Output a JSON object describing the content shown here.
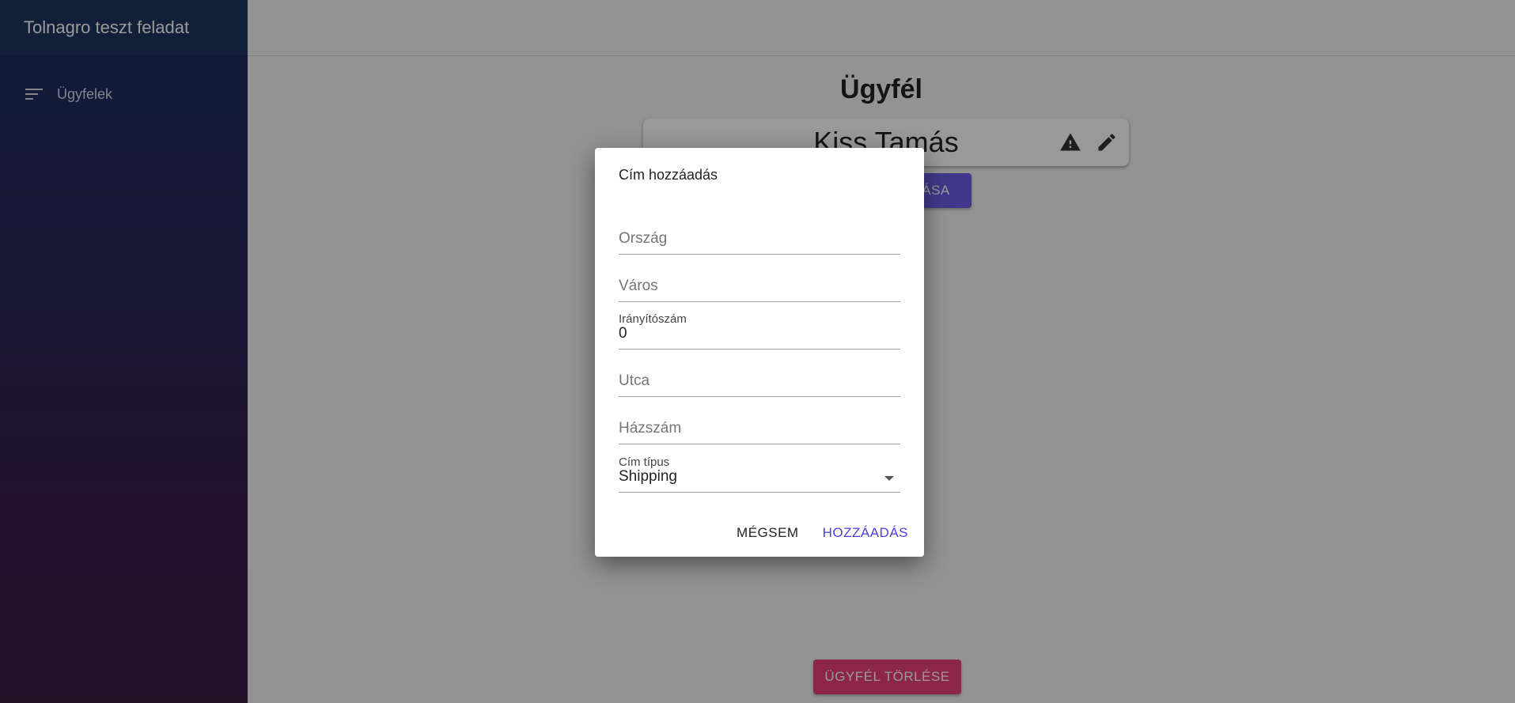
{
  "app": {
    "title": "Tolnagro teszt feladat"
  },
  "sidebar": {
    "items": [
      {
        "label": "Ügyfelek",
        "icon": "menu-lines-icon"
      }
    ]
  },
  "page": {
    "title": "Ügyfél",
    "customer_name": "Kiss Tamás",
    "add_address_button": "ÁSA",
    "delete_button": "ÜGYFÉL TÖRLÉSE"
  },
  "dialog": {
    "title": "Cím hozzáadás",
    "fields": {
      "country": {
        "placeholder": "Ország"
      },
      "city": {
        "placeholder": "Város"
      },
      "zip": {
        "label": "Irányítószám",
        "value": "0"
      },
      "street": {
        "placeholder": "Utca"
      },
      "house_number": {
        "placeholder": "Házszám"
      },
      "address_type": {
        "label": "Cím típus",
        "value": "Shipping"
      }
    },
    "actions": {
      "cancel": "MÉGSEM",
      "add": "HOZZÁADÁS"
    }
  },
  "colors": {
    "accent": "#4a3fe0",
    "primary_button": "#6d5ee8",
    "danger_button": "#e9407a",
    "sidebar_top": "#1c2d62",
    "sidebar_bottom": "#3b1c42"
  }
}
